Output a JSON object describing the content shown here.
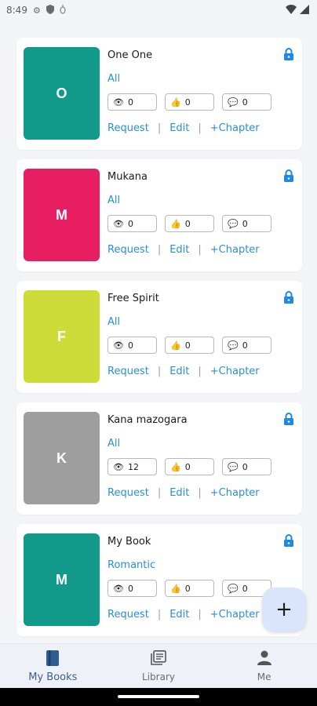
{
  "status_bar": {
    "time": "8:49",
    "left_icons": [
      "gear-icon",
      "shield-icon",
      "debug-icon"
    ],
    "right_icons": [
      "wifi-icon",
      "signal-icon"
    ]
  },
  "books": [
    {
      "initial": "O",
      "title": "One One",
      "category": "All",
      "cover_color": "#119a8a",
      "views": "0",
      "likes": "0",
      "comments": "0"
    },
    {
      "initial": "M",
      "title": "Mukana",
      "category": "All",
      "cover_color": "#e81e63",
      "views": "0",
      "likes": "0",
      "comments": "0"
    },
    {
      "initial": "F",
      "title": "Free Spirit",
      "category": "All",
      "cover_color": "#cddc39",
      "views": "0",
      "likes": "0",
      "comments": "0"
    },
    {
      "initial": "K",
      "title": "Kana mazogara",
      "category": "All",
      "cover_color": "#9e9e9e",
      "views": "12",
      "likes": "0",
      "comments": "0"
    },
    {
      "initial": "M",
      "title": "My Book",
      "category": "Romantic",
      "cover_color": "#119a8a",
      "views": "0",
      "likes": "0",
      "comments": "0"
    }
  ],
  "actions": {
    "request": "Request",
    "separator": "|",
    "edit": "Edit",
    "add_chapter": "+Chapter"
  },
  "fab": {
    "label": "+"
  },
  "bottom_nav": {
    "items": [
      {
        "label": "My Books",
        "icon": "book-icon",
        "active": true
      },
      {
        "label": "Library",
        "icon": "library-icon",
        "active": false
      },
      {
        "label": "Me",
        "icon": "person-icon",
        "active": false
      }
    ]
  },
  "colors": {
    "accent": "#2a8fd6",
    "background": "#f3f4f8",
    "nav_active": "#3b5f8c",
    "fab_background": "#d8e5fb"
  }
}
